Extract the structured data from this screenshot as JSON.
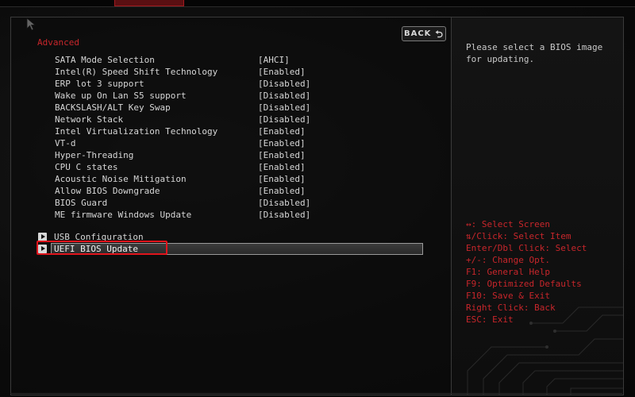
{
  "section": {
    "title": "Advanced"
  },
  "back_button": {
    "label": "BACK",
    "icon": "back-arrow-icon"
  },
  "settings": [
    {
      "label": "SATA Mode Selection",
      "value": "[AHCI]"
    },
    {
      "label": "Intel(R) Speed Shift Technology",
      "value": "[Enabled]"
    },
    {
      "label": "ERP lot 3 support",
      "value": "[Disabled]"
    },
    {
      "label": "Wake up On Lan S5 support",
      "value": "[Disabled]"
    },
    {
      "label": "BACKSLASH/ALT Key Swap",
      "value": "[Disabled]"
    },
    {
      "label": "Network Stack",
      "value": "[Disabled]"
    },
    {
      "label": "Intel Virtualization Technology",
      "value": "[Enabled]"
    },
    {
      "label": "VT-d",
      "value": "[Enabled]"
    },
    {
      "label": "Hyper-Threading",
      "value": "[Enabled]"
    },
    {
      "label": "CPU C states",
      "value": "[Enabled]"
    },
    {
      "label": "Acoustic Noise Mitigation",
      "value": "[Enabled]"
    },
    {
      "label": "Allow BIOS Downgrade",
      "value": "[Enabled]"
    },
    {
      "label": "BIOS Guard",
      "value": "[Disabled]"
    },
    {
      "label": "ME firmware Windows Update",
      "value": "[Disabled]"
    }
  ],
  "submenus": [
    {
      "label": "USB Configuration",
      "selected": false
    },
    {
      "label": "UEFI BIOS Update",
      "selected": true
    }
  ],
  "help": {
    "description": "Please select a BIOS image\nfor updating.",
    "keys": [
      "↔: Select Screen",
      "⇅/Click: Select Item",
      "Enter/Dbl Click: Select",
      "+/-: Change Opt.",
      "F1: General Help",
      "F9: Optimized Defaults",
      "F10: Save & Exit",
      "Right Click: Back",
      "ESC: Exit"
    ]
  },
  "colors": {
    "accent_red": "#c8262b",
    "highlight_red": "#e0141c",
    "text": "#d6d6d6",
    "background": "#0b0b0b"
  }
}
